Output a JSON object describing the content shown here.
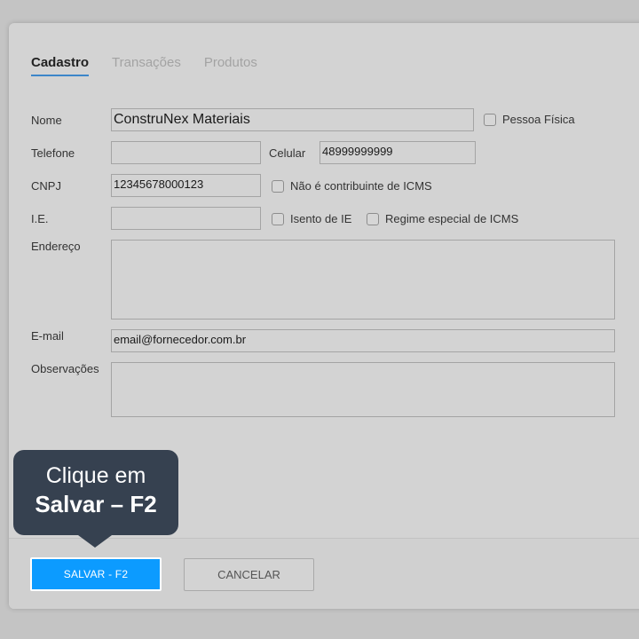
{
  "tabs": [
    {
      "label": "Cadastro",
      "active": true
    },
    {
      "label": "Transações",
      "active": false
    },
    {
      "label": "Produtos",
      "active": false
    }
  ],
  "form": {
    "nome": {
      "label": "Nome",
      "value": "ConstruNex Materiais"
    },
    "pessoa_fisica": {
      "label": "Pessoa Física",
      "checked": false
    },
    "telefone": {
      "label": "Telefone",
      "value": ""
    },
    "celular": {
      "label": "Celular",
      "value": "48999999999"
    },
    "cnpj": {
      "label": "CNPJ",
      "value": "12345678000123"
    },
    "nao_contribuinte": {
      "label": "Não é contribuinte de ICMS",
      "checked": false
    },
    "ie": {
      "label": "I.E.",
      "value": ""
    },
    "isento_ie": {
      "label": "Isento de IE",
      "checked": false
    },
    "regime_especial": {
      "label": "Regime especial de ICMS",
      "checked": false
    },
    "endereco": {
      "label": "Endereço",
      "value": ""
    },
    "email": {
      "label": "E-mail",
      "value": "email@fornecedor.com.br"
    },
    "observacoes": {
      "label": "Observações",
      "value": ""
    }
  },
  "footer": {
    "save_label": "SALVAR - F2",
    "cancel_label": "CANCELAR"
  },
  "tooltip": {
    "line1": "Clique em",
    "line2": "Salvar – F2"
  },
  "colors": {
    "accent": "#0c9bff",
    "tab_underline": "#3c86c9",
    "tooltip_bg": "#364150"
  }
}
